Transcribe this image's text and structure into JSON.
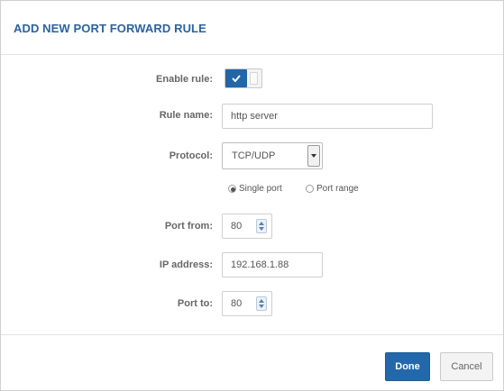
{
  "dialog": {
    "title": "ADD NEW PORT FORWARD RULE"
  },
  "form": {
    "enable_rule": {
      "label": "Enable rule:",
      "checked": true
    },
    "rule_name": {
      "label": "Rule name:",
      "value": "http server"
    },
    "protocol": {
      "label": "Protocol:",
      "value": "TCP/UDP"
    },
    "port_mode": {
      "options": [
        {
          "label": "Single port",
          "checked": true
        },
        {
          "label": "Port range",
          "checked": false
        }
      ]
    },
    "port_from": {
      "label": "Port from:",
      "value": "80"
    },
    "ip_address": {
      "label": "IP address:",
      "value": "192.168.1.88"
    },
    "port_to": {
      "label": "Port to:",
      "value": "80"
    }
  },
  "footer": {
    "done_label": "Done",
    "cancel_label": "Cancel"
  },
  "colors": {
    "accent": "#2268ab",
    "title": "#2b62a0"
  },
  "icons": {
    "toggle": "checkmark-icon",
    "select": "chevron-down-icon",
    "spinner": "spinner-arrows-icon"
  }
}
